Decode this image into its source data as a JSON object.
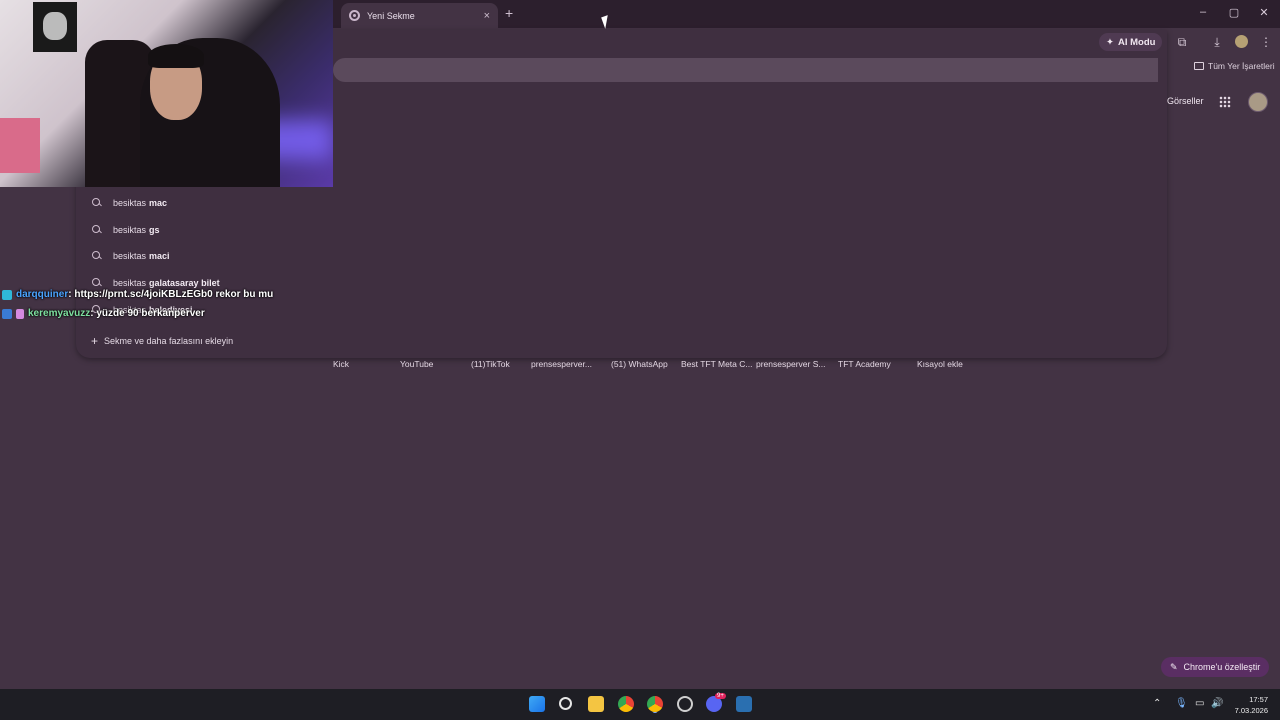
{
  "browser": {
    "tab_title": "Yeni Sekme",
    "tab_close": "×",
    "new_tab": "+",
    "window_controls": {
      "minimize": "–",
      "maximize": "▢",
      "close": "✕"
    },
    "ai_mode_label": "AI Modu",
    "all_bookmarks": "Tüm Yer İşaretleri"
  },
  "omnibox": {
    "suggestions": [
      {
        "prefix": "besiktas",
        "bold": "mac"
      },
      {
        "prefix": "besiktas",
        "bold": "gs"
      },
      {
        "prefix": "besiktas",
        "bold": "maci"
      },
      {
        "prefix": "besiktas",
        "bold": "galatasaray bilet"
      },
      {
        "prefix": "besiktas",
        "bold": "belediyesi"
      }
    ],
    "add_tabs_label": "Sekme ve daha fazlasını ekleyin"
  },
  "google": {
    "images_link": "Görseller"
  },
  "shortcuts": [
    "Kick",
    "YouTube",
    "(11)TikTok",
    "prensesperver...",
    "(51) WhatsApp",
    "Best TFT Meta C...",
    "prensesperver S...",
    "TFT Academy",
    "Kısayol ekle"
  ],
  "chat": [
    {
      "user": "darqquiner",
      "message": ": https://prnt.sc/4joiKBLzEGb0 rekor bu mu"
    },
    {
      "user": "keremyavuzz",
      "message": ": yüzde 90 berkanperver"
    }
  ],
  "customize_label": "Chrome'u özelleştir",
  "taskbar": {
    "time": "17:57",
    "date": "7.03.2026",
    "discord_badge": "9+"
  },
  "colors": {
    "background": "#433344",
    "tabstrip": "#2c1f2d",
    "accent": "#5a2e63"
  }
}
